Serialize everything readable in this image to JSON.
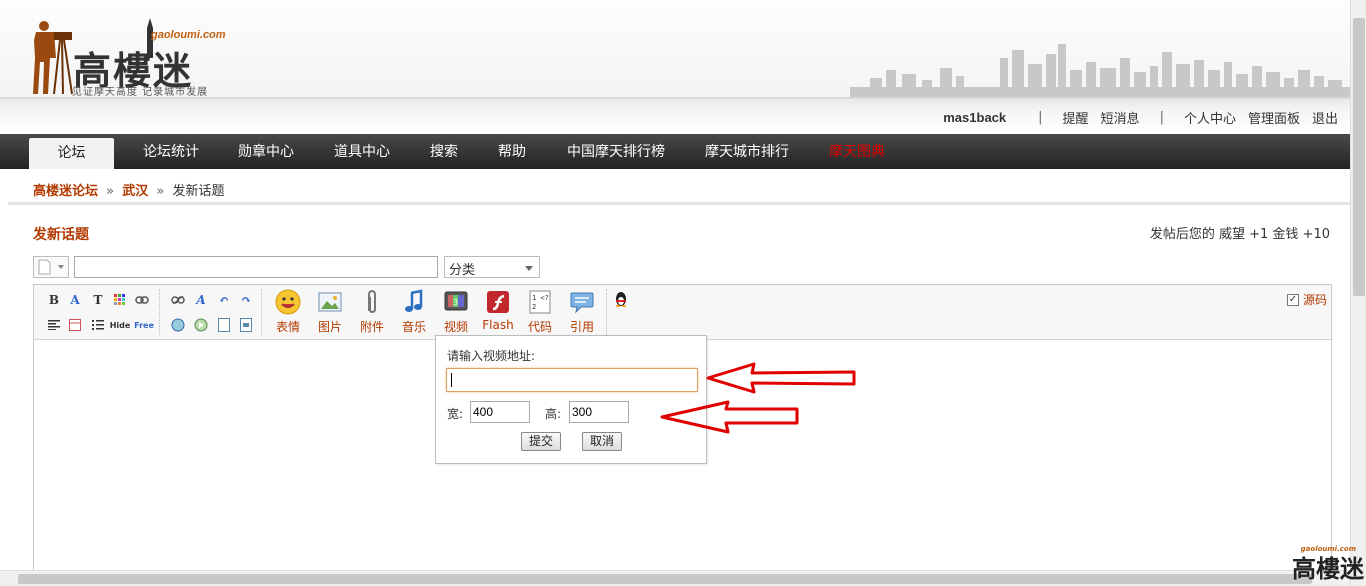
{
  "logo": {
    "domain": "gaoloumi.com",
    "title": "高樓迷",
    "slogan": "见证摩天高度 记录城市发展"
  },
  "userbar": {
    "username": "mas1back",
    "links": [
      "提醒",
      "短消息",
      "个人中心",
      "管理面板",
      "退出"
    ]
  },
  "nav": {
    "items": [
      "论坛",
      "论坛统计",
      "勋章中心",
      "道具中心",
      "搜索",
      "帮助",
      "中国摩天排行榜",
      "摩天城市排行",
      "摩天图典"
    ],
    "active_index": 0
  },
  "breadcrumb": {
    "forum": "高楼迷论坛",
    "board": "武汉",
    "current": "发新话题",
    "separator": "»"
  },
  "post": {
    "title": "发新话题",
    "reward_text": "发帖后您的 威望 +1  金钱 +10",
    "subject_value": "",
    "category_label": "分类"
  },
  "toolbar": {
    "big_buttons": [
      "表情",
      "图片",
      "附件",
      "音乐",
      "视频",
      "Flash",
      "代码",
      "引用"
    ],
    "source_label": "源码",
    "source_checked": true
  },
  "video_popup": {
    "prompt": "请输入视频地址:",
    "url_value": "",
    "width_label": "宽:",
    "width_value": "400",
    "height_label": "高:",
    "height_value": "300",
    "submit_label": "提交",
    "cancel_label": "取消"
  },
  "colors": {
    "accent": "#b33a00",
    "nav_bg": "#333333",
    "special_link": "#e00000",
    "arrow": "#e00000"
  },
  "watermark": {
    "title": "高樓迷",
    "domain": "gaoloumi.com"
  }
}
